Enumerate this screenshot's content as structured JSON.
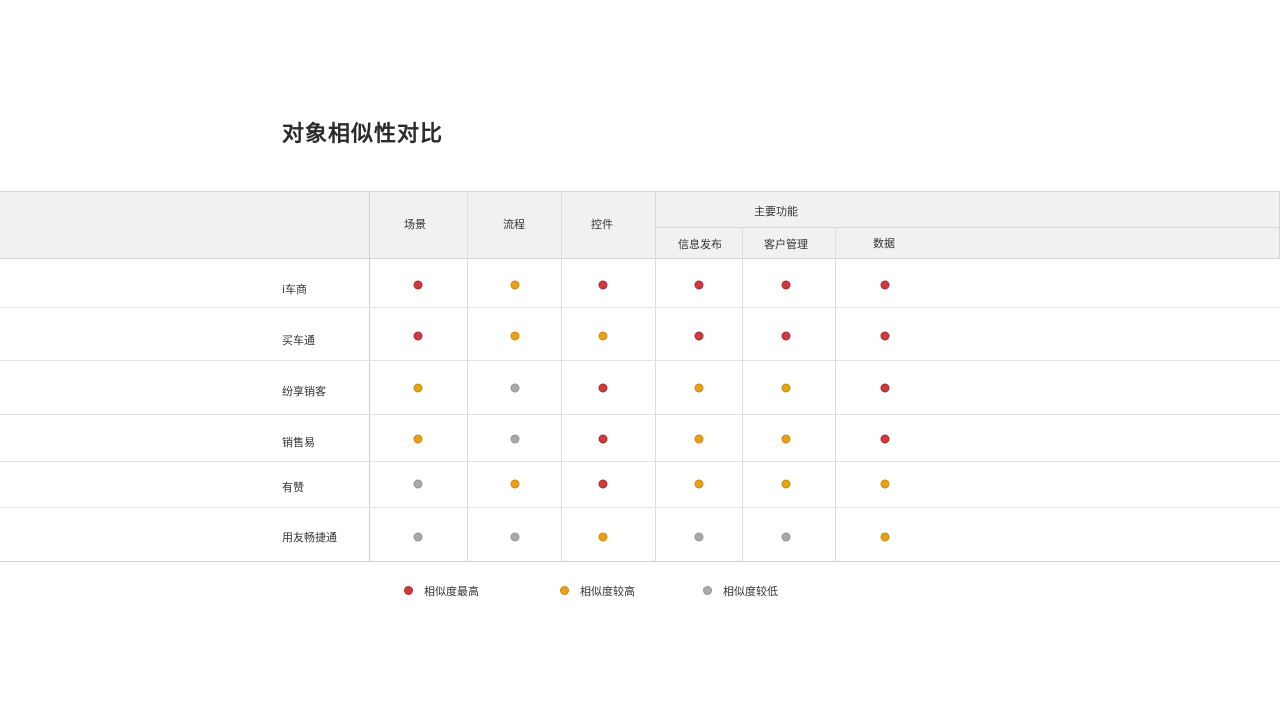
{
  "title": "对象相似性对比",
  "headers": {
    "scene": "场景",
    "process": "流程",
    "controls": "控件",
    "main_functions": "主要功能",
    "info_publish": "信息发布",
    "customer_mgmt": "客户管理",
    "data": "数据"
  },
  "rows": [
    {
      "name": "i车商",
      "values": [
        "high",
        "mid",
        "high",
        "high",
        "high",
        "high"
      ]
    },
    {
      "name": "买车通",
      "values": [
        "high",
        "mid",
        "mid",
        "high",
        "high",
        "high"
      ]
    },
    {
      "name": "纷享销客",
      "values": [
        "mid",
        "low",
        "high",
        "mid",
        "mid",
        "high"
      ]
    },
    {
      "name": "销售易",
      "values": [
        "mid",
        "low",
        "high",
        "mid",
        "mid",
        "high"
      ]
    },
    {
      "name": "有赞",
      "values": [
        "low",
        "mid",
        "high",
        "mid",
        "mid",
        "mid"
      ]
    },
    {
      "name": "用友畅捷通",
      "values": [
        "low",
        "low",
        "mid",
        "low",
        "low",
        "mid"
      ]
    }
  ],
  "legend": [
    {
      "key": "high",
      "label": "相似度最高",
      "color": "#d0393f"
    },
    {
      "key": "mid",
      "label": "相似度较高",
      "color": "#e9a014"
    },
    {
      "key": "low",
      "label": "相似度较低",
      "color": "#a9a9a9"
    }
  ]
}
